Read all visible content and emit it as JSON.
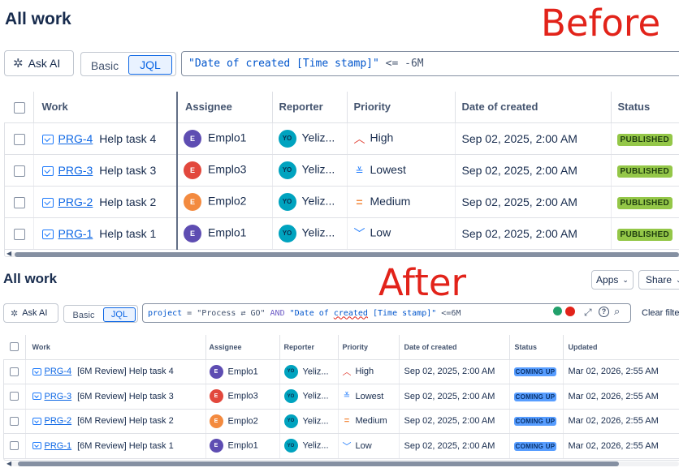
{
  "before": {
    "title": "All work",
    "annotation": "Before",
    "ask_ai": "Ask AI",
    "mode_basic": "Basic",
    "mode_jql": "JQL",
    "query": {
      "field": "\"Date of created [Time stamp]\"",
      "op": " <= ",
      "value": "-6M"
    },
    "columns": [
      "Work",
      "Assignee",
      "Reporter",
      "Priority",
      "Date of created",
      "Status"
    ],
    "rows": [
      {
        "key": "PRG-4",
        "summary": "Help task 4",
        "assignee": "Emplo1",
        "assignee_initial": "E",
        "reporter": "Yeliz...",
        "reporter_initial": "YO",
        "priority": "High",
        "date": "Sep 02, 2025, 2:00 AM",
        "status": "PUBLISHED"
      },
      {
        "key": "PRG-3",
        "summary": "Help task 3",
        "assignee": "Emplo3",
        "assignee_initial": "E",
        "reporter": "Yeliz...",
        "reporter_initial": "YO",
        "priority": "Lowest",
        "date": "Sep 02, 2025, 2:00 AM",
        "status": "PUBLISHED"
      },
      {
        "key": "PRG-2",
        "summary": "Help task 2",
        "assignee": "Emplo2",
        "assignee_initial": "E",
        "reporter": "Yeliz...",
        "reporter_initial": "YO",
        "priority": "Medium",
        "date": "Sep 02, 2025, 2:00 AM",
        "status": "PUBLISHED"
      },
      {
        "key": "PRG-1",
        "summary": "Help task 1",
        "assignee": "Emplo1",
        "assignee_initial": "E",
        "reporter": "Yeliz...",
        "reporter_initial": "YO",
        "priority": "Low",
        "date": "Sep 02, 2025, 2:00 AM",
        "status": "PUBLISHED"
      }
    ]
  },
  "after": {
    "title": "All work",
    "annotation": "After",
    "apps": "Apps",
    "share": "Share",
    "ask_ai": "Ask AI",
    "mode_basic": "Basic",
    "mode_jql": "JQL",
    "clear_filters": "Clear filters",
    "query": {
      "kw1": "project",
      "eq": " = ",
      "project_val": "\"Process ⇄ GO\"",
      "and": " AND ",
      "field_a": "\"Date of ",
      "field_err": "created",
      "field_b": " [Time stamp]\"",
      "op": " <=",
      "value": "6M"
    },
    "columns": [
      "Work",
      "Assignee",
      "Reporter",
      "Priority",
      "Date of created",
      "Status",
      "Updated"
    ],
    "rows": [
      {
        "key": "PRG-4",
        "summary": "[6M Review] Help task 4",
        "assignee": "Emplo1",
        "assignee_initial": "E",
        "reporter": "Yeliz...",
        "reporter_initial": "YO",
        "priority": "High",
        "date": "Sep 02, 2025, 2:00 AM",
        "status": "COMING UP",
        "updated": "Mar 02, 2026, 2:55 AM"
      },
      {
        "key": "PRG-3",
        "summary": "[6M Review] Help task 3",
        "assignee": "Emplo3",
        "assignee_initial": "E",
        "reporter": "Yeliz...",
        "reporter_initial": "YO",
        "priority": "Lowest",
        "date": "Sep 02, 2025, 2:00 AM",
        "status": "COMING UP",
        "updated": "Mar 02, 2026, 2:55 AM"
      },
      {
        "key": "PRG-2",
        "summary": "[6M Review] Help task 2",
        "assignee": "Emplo2",
        "assignee_initial": "E",
        "reporter": "Yeliz...",
        "reporter_initial": "YO",
        "priority": "Medium",
        "date": "Sep 02, 2025, 2:00 AM",
        "status": "COMING UP",
        "updated": "Mar 02, 2026, 2:55 AM"
      },
      {
        "key": "PRG-1",
        "summary": "[6M Review] Help task 1",
        "assignee": "Emplo1",
        "assignee_initial": "E",
        "reporter": "Yeliz...",
        "reporter_initial": "YO",
        "priority": "Low",
        "date": "Sep 02, 2025, 2:00 AM",
        "status": "COMING UP",
        "updated": "Mar 02, 2026, 2:55 AM"
      }
    ]
  },
  "colors": {
    "emplo1": "#5e4db2",
    "emplo2": "#f38a3f",
    "emplo3": "#e2483d",
    "high": "#e2483d",
    "lowest": "#1d7afc",
    "medium": "#f38a3f",
    "low": "#1d7afc"
  },
  "icons": {
    "ask_ai": "sparkle-icon",
    "priority_high": "chevron-up-icon",
    "priority_lowest": "double-chevron-down-icon",
    "priority_medium": "equals-icon",
    "priority_low": "chevron-down-icon",
    "work_type": "task-checkbox-icon"
  }
}
